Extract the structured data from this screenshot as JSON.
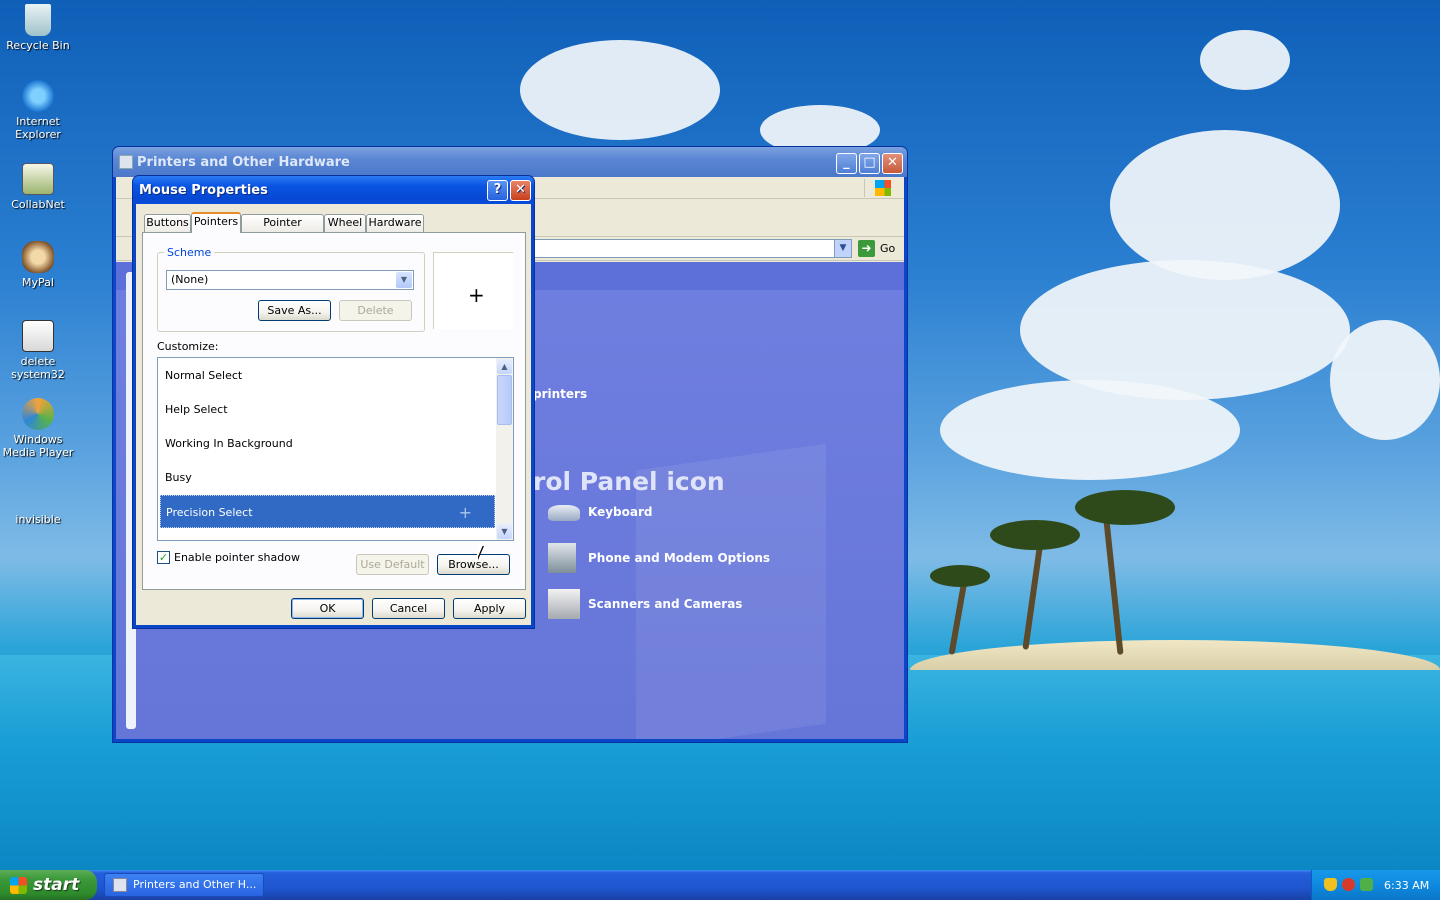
{
  "desktop": {
    "icons": [
      {
        "label": "Recycle Bin"
      },
      {
        "label": "Internet Explorer"
      },
      {
        "label": "CollabNet"
      },
      {
        "label": "MyPal"
      },
      {
        "label": "delete system32"
      },
      {
        "label": "Windows Media Player"
      },
      {
        "label": "invisible"
      }
    ]
  },
  "explorer": {
    "title": "Printers and Other Hardware",
    "go_label": "Go",
    "content": {
      "link_top": "printers",
      "section_title": "rol Panel icon",
      "items": [
        {
          "label": "Keyboard"
        },
        {
          "label": "Phone and Modem Options"
        },
        {
          "label": "Scanners and Cameras"
        }
      ]
    }
  },
  "dialog": {
    "title": "Mouse Properties",
    "help_glyph": "?",
    "close_glyph": "✕",
    "tabs": [
      "Buttons",
      "Pointers",
      "Pointer Options",
      "Wheel",
      "Hardware"
    ],
    "active_tab": "Pointers",
    "scheme": {
      "legend": "Scheme",
      "value": "(None)",
      "save_as_label": "Save As...",
      "delete_label": "Delete"
    },
    "customize_label": "Customize:",
    "cursor_list": [
      {
        "label": "Normal Select"
      },
      {
        "label": "Help Select"
      },
      {
        "label": "Working In Background"
      },
      {
        "label": "Busy"
      },
      {
        "label": "Precision Select"
      }
    ],
    "selected_item": "Precision Select",
    "enable_shadow_label": "Enable pointer shadow",
    "enable_shadow_checked": true,
    "use_default_label": "Use Default",
    "browse_label": "Browse...",
    "ok_label": "OK",
    "cancel_label": "Cancel",
    "apply_label": "Apply"
  },
  "taskbar": {
    "start_label": "start",
    "task_label": "Printers and Other H...",
    "clock": "6:33 AM"
  }
}
